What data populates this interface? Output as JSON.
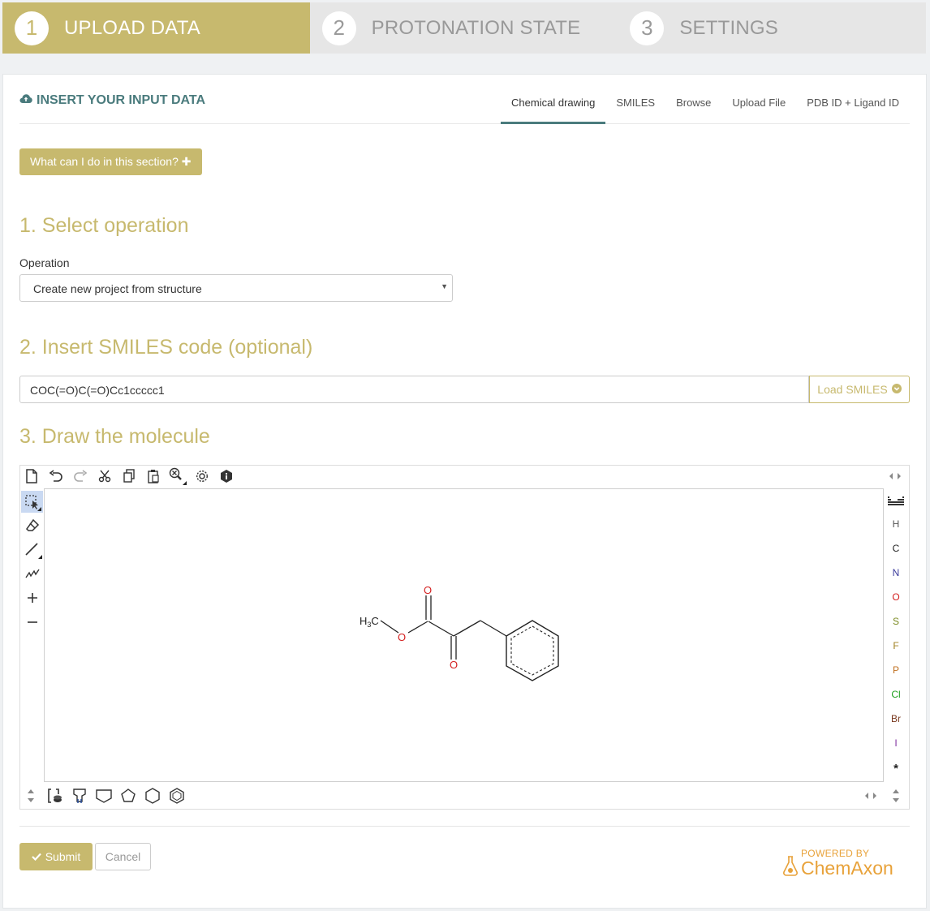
{
  "stepper": [
    {
      "number": "1",
      "label": "UPLOAD DATA"
    },
    {
      "number": "2",
      "label": "PROTONATION STATE"
    },
    {
      "number": "3",
      "label": "SETTINGS"
    }
  ],
  "panel": {
    "title": "INSERT YOUR INPUT DATA",
    "tabs": [
      "Chemical drawing",
      "SMILES",
      "Browse",
      "Upload File",
      "PDB ID + Ligand ID"
    ],
    "active_tab": "Chemical drawing"
  },
  "help_button": "What can I do in this section? ✚",
  "sections": {
    "select_operation": "1. Select operation",
    "insert_smiles": "2. Insert SMILES code (optional)",
    "draw_molecule": "3. Draw the molecule"
  },
  "operation": {
    "label": "Operation",
    "value": "Create new project from structure"
  },
  "smiles": {
    "value": "COC(=O)C(=O)Cc1ccccc1",
    "button": "Load SMILES"
  },
  "editor": {
    "atoms": [
      {
        "symbol": "H",
        "color": "#555555"
      },
      {
        "symbol": "C",
        "color": "#222222"
      },
      {
        "symbol": "N",
        "color": "#3a3a9c"
      },
      {
        "symbol": "O",
        "color": "#d42020"
      },
      {
        "symbol": "S",
        "color": "#7a8a20"
      },
      {
        "symbol": "F",
        "color": "#a08020"
      },
      {
        "symbol": "P",
        "color": "#c07020"
      },
      {
        "symbol": "Cl",
        "color": "#20a020"
      },
      {
        "symbol": "Br",
        "color": "#7a3a20"
      },
      {
        "symbol": "I",
        "color": "#8030a0"
      },
      {
        "symbol": "*",
        "color": "#222222"
      }
    ],
    "molecule_labels": {
      "methyl": "H3C",
      "oxygen": "O"
    }
  },
  "footer": {
    "submit": "Submit",
    "cancel": "Cancel",
    "powered_by": "POWERED BY",
    "brand": "ChemAxon"
  },
  "colors": {
    "accent": "#c7b96e",
    "teal": "#4a7b7d",
    "oxygen": "#d42020"
  }
}
